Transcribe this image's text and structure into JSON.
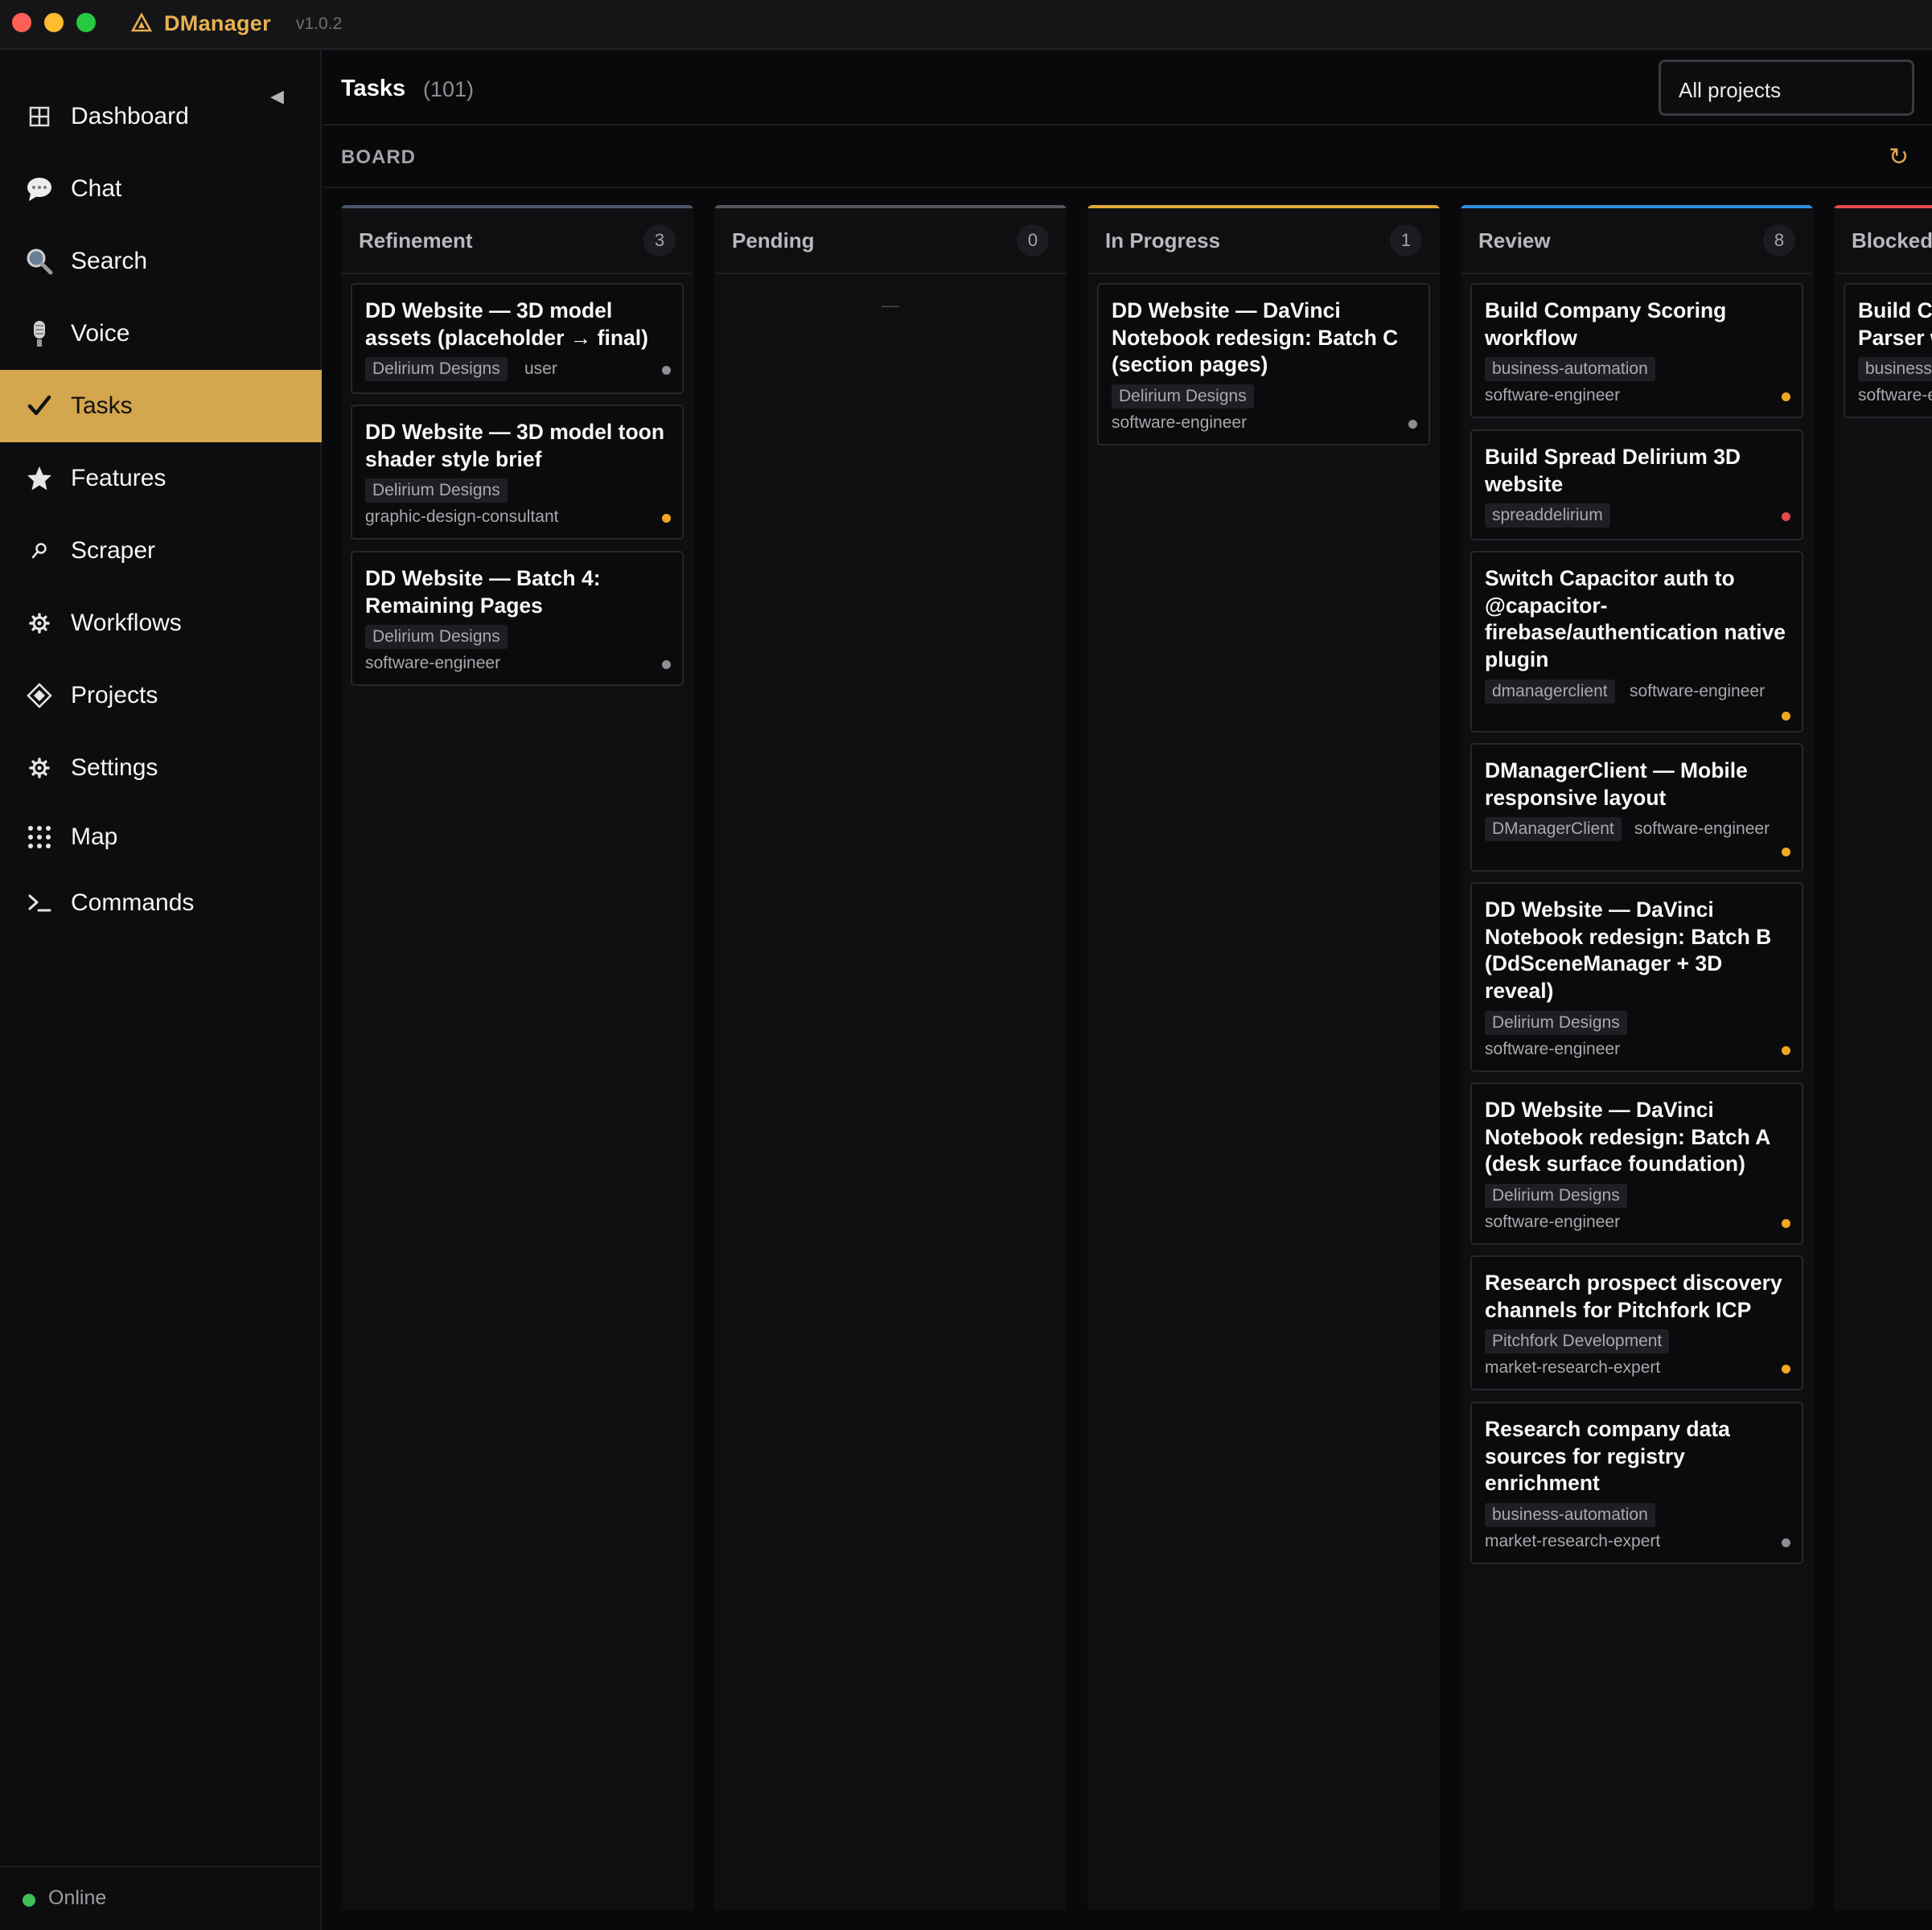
{
  "app": {
    "name": "DManager",
    "version": "v1.0.2"
  },
  "sidebar": {
    "items": [
      {
        "label": "Dashboard",
        "icon": "grid-icon"
      },
      {
        "label": "Chat",
        "icon": "chat-bubble-icon"
      },
      {
        "label": "Search",
        "icon": "magnifier-icon"
      },
      {
        "label": "Voice",
        "icon": "microphone-icon"
      },
      {
        "label": "Tasks",
        "icon": "checkmark-icon",
        "active": true
      },
      {
        "label": "Features",
        "icon": "star-icon"
      },
      {
        "label": "Scraper",
        "icon": "key-icon"
      },
      {
        "label": "Workflows",
        "icon": "gear-icon"
      },
      {
        "label": "Projects",
        "icon": "diamond-icon"
      },
      {
        "label": "Settings",
        "icon": "gear-icon"
      },
      {
        "label": "Map",
        "icon": "dot-grid-icon"
      },
      {
        "label": "Commands",
        "icon": "terminal-icon"
      }
    ],
    "status": "Online"
  },
  "header": {
    "title": "Tasks",
    "count": "(101)",
    "project_filter": "All projects"
  },
  "board": {
    "label": "BOARD",
    "columns": [
      {
        "title": "Refinement",
        "count": "3",
        "cards": [
          {
            "title": "DD Website — 3D model assets (placeholder → final)",
            "tag": "Delirium Designs",
            "agent": "user",
            "priority": "#8e8e93"
          },
          {
            "title": "DD Website — 3D model toon shader style brief",
            "tag": "Delirium Designs",
            "agent": "graphic-design-consultant",
            "priority": "#f0a81e"
          },
          {
            "title": "DD Website — Batch 4: Remaining Pages",
            "tag": "Delirium Designs",
            "agent": "software-engineer",
            "priority": "#8e8e93"
          }
        ]
      },
      {
        "title": "Pending",
        "count": "0",
        "empty": "—",
        "cards": []
      },
      {
        "title": "In Progress",
        "count": "1",
        "cards": [
          {
            "title": "DD Website — DaVinci Notebook redesign: Batch C (section pages)",
            "tag": "Delirium Designs",
            "agent": "software-engineer",
            "priority": "#8e8e93"
          }
        ]
      },
      {
        "title": "Review",
        "count": "8",
        "cards": [
          {
            "title": "Build Company Scoring workflow",
            "tag": "business-automation",
            "agent": "software-engineer",
            "priority": "#f0a81e"
          },
          {
            "title": "Build Spread Delirium 3D website",
            "tag": "spreaddelirium",
            "agent": "",
            "priority": "#e5484d"
          },
          {
            "title": "Switch Capacitor auth to @capacitor-firebase/authentication native plugin",
            "tag": "dmanagerclient",
            "agent": "software-engineer",
            "priority": "#f0a81e"
          },
          {
            "title": "DManagerClient — Mobile responsive layout",
            "tag": "DManagerClient",
            "agent": "software-engineer",
            "priority": "#f0a81e"
          },
          {
            "title": "DD Website — DaVinci Notebook redesign: Batch B (DdSceneManager + 3D reveal)",
            "tag": "Delirium Designs",
            "agent": "software-engineer",
            "priority": "#f0a81e"
          },
          {
            "title": "DD Website — DaVinci Notebook redesign: Batch A (desk surface foundation)",
            "tag": "Delirium Designs",
            "agent": "software-engineer",
            "priority": "#f0a81e"
          },
          {
            "title": "Research prospect discovery channels for Pitchfork ICP",
            "tag": "Pitchfork Development",
            "agent": "market-research-expert",
            "priority": "#f0a81e"
          },
          {
            "title": "Research company data sources for registry enrichment",
            "tag": "business-automation",
            "agent": "market-research-expert",
            "priority": "#8e8e93"
          }
        ]
      },
      {
        "title": "Blocked",
        "count": "",
        "cards": [
          {
            "title": "Build Company Scoring Parser workflow",
            "tag": "business-automation",
            "agent": "software-engineer",
            "priority": "#f0a81e"
          }
        ]
      }
    ]
  },
  "colors": {
    "accent": "#d4a64e",
    "refinement_bar": "#4a5568",
    "pending_bar": "#55555b",
    "in_progress_bar": "#e0a93a",
    "review_bar": "#2f8fe0",
    "blocked_bar": "#e5484d"
  }
}
